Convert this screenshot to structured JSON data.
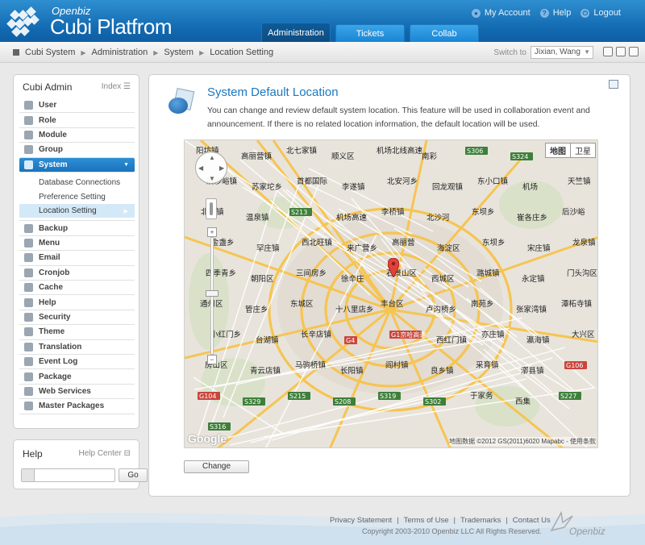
{
  "app": {
    "brand_small": "Openbiz",
    "brand_big": "Cubi Platfrom"
  },
  "toplinks": [
    {
      "label": "My Account",
      "icon": "user-icon"
    },
    {
      "label": "Help",
      "icon": "help-icon"
    },
    {
      "label": "Logout",
      "icon": "logout-icon"
    }
  ],
  "tabs": [
    {
      "label": "Administration",
      "active": true
    },
    {
      "label": "Tickets",
      "active": false
    },
    {
      "label": "Collab",
      "active": false
    }
  ],
  "breadcrumb": [
    "Cubi System",
    "Administration",
    "System",
    "Location Setting"
  ],
  "switch_to": {
    "label": "Switch to",
    "value": "Jixian, Wang"
  },
  "sidebar": {
    "title": "Cubi Admin",
    "index_label": "Index",
    "items": [
      {
        "label": "User",
        "icon": "user-icon"
      },
      {
        "label": "Role",
        "icon": "key-icon"
      },
      {
        "label": "Module",
        "icon": "module-icon"
      },
      {
        "label": "Group",
        "icon": "group-icon"
      },
      {
        "label": "System",
        "icon": "gear-icon",
        "active": true
      },
      {
        "label": "Backup",
        "icon": "backup-icon"
      },
      {
        "label": "Menu",
        "icon": "menu-icon"
      },
      {
        "label": "Email",
        "icon": "email-icon"
      },
      {
        "label": "Cronjob",
        "icon": "cronjob-icon"
      },
      {
        "label": "Cache",
        "icon": "cache-icon"
      },
      {
        "label": "Help",
        "icon": "help-icon"
      },
      {
        "label": "Security",
        "icon": "shield-icon"
      },
      {
        "label": "Theme",
        "icon": "theme-icon"
      },
      {
        "label": "Translation",
        "icon": "translation-icon"
      },
      {
        "label": "Event Log",
        "icon": "eventlog-icon"
      },
      {
        "label": "Package",
        "icon": "package-icon"
      },
      {
        "label": "Web Services",
        "icon": "webservices-icon"
      },
      {
        "label": "Master Packages",
        "icon": "masterpackages-icon"
      }
    ],
    "subitems": [
      {
        "label": "Database Connections",
        "active": false
      },
      {
        "label": "Preference Setting",
        "active": false
      },
      {
        "label": "Location Setting",
        "active": true
      }
    ]
  },
  "help_box": {
    "title": "Help",
    "center_label": "Help Center",
    "go_label": "Go",
    "search_value": ""
  },
  "main": {
    "title": "System Default Location",
    "description": "You can change and review default system location. This feature will be used in collaboration event and announcement. If there is no related location information, the default location will be used.",
    "change_button": "Change"
  },
  "map": {
    "type_buttons": [
      "地图",
      "卫星"
    ],
    "copyright": "地图数据 ©2012 GS(2011)6020 Mapabc - 使用条款",
    "google_mark": "Google",
    "labels": [
      "阳坊镇",
      "高丽营镇",
      "北七家镇",
      "顺义区",
      "机场北线高速",
      "南彩",
      "S306",
      "S324",
      "S309",
      "后沙峪镇",
      "苏家坨乡",
      "首都国际",
      "李遂镇",
      "北安河乡",
      "回龙观镇",
      "东小口镇",
      "机场",
      "天竺镇",
      "北务镇",
      "温泉镇",
      "S213",
      "机场高速",
      "李桥镇",
      "北沙河",
      "东坝乡",
      "崔各庄乡",
      "后沙峪",
      "金盏乡",
      "罕庄镇",
      "西北旺镇",
      "来广营乡",
      "高丽营",
      "海淀区",
      "东坝乡",
      "宋庄镇",
      "龙泉镇",
      "四季青乡",
      "朝阳区",
      "三间房乡",
      "徐辛庄",
      "石景山区",
      "西城区",
      "潞城镇",
      "永定镇",
      "门头沟区",
      "通州区",
      "管庄乡",
      "东城区",
      "十八里店乡",
      "丰台区",
      "卢沟桥乡",
      "南苑乡",
      "张家湾镇",
      "潭柘寺镇",
      "小红门乡",
      "台湖镇",
      "长辛店镇",
      "G4",
      "G1京哈高速",
      "西红门镇",
      "亦庄镇",
      "瀛海镇",
      "大兴区",
      "房山区",
      "青云店镇",
      "马驹桥镇",
      "长阳镇",
      "阎村镇",
      "良乡镇",
      "采育镇",
      "漷县镇",
      "G106",
      "G104",
      "S329",
      "S215",
      "S208",
      "S319",
      "S302",
      "于家务",
      "西集",
      "S227",
      "S316"
    ]
  },
  "footer": {
    "links": [
      "Privacy Statement",
      "Terms of Use",
      "Trademarks",
      "Contact Us"
    ],
    "copyright": "Copyright 2003-2010 Openbiz LLC All Rights Reserved.",
    "logo_text": "Openbiz"
  },
  "colors": {
    "brand_blue": "#1a78c2",
    "header_blue": "#1269b0",
    "active_menu": "#2d8fd5",
    "map_road": "#f6c451",
    "map_bg": "#eae6df"
  }
}
